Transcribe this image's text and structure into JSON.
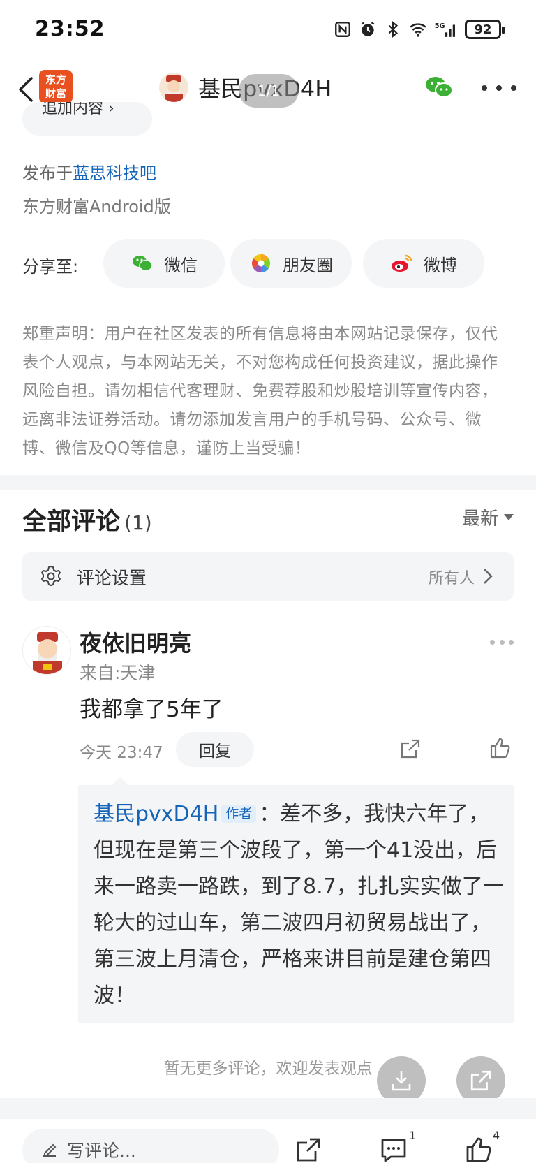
{
  "status": {
    "time": "23:52",
    "battery": "92",
    "network": "5G"
  },
  "nav": {
    "logo_line1": "东方",
    "logo_line2": "财富",
    "title": "基民pvxD4H",
    "page_indicator": "1/1"
  },
  "post": {
    "cut_pill_text": "追加内容 ›",
    "published_prefix": "发布于",
    "published_forum": "蓝思科技吧",
    "client": "东方财富Android版"
  },
  "share": {
    "label": "分享至:",
    "buttons": [
      {
        "label": "微信",
        "icon": "wechat-icon"
      },
      {
        "label": "朋友圈",
        "icon": "moments-icon"
      },
      {
        "label": "微博",
        "icon": "weibo-icon"
      }
    ]
  },
  "disclaimer": "郑重声明：用户在社区发表的所有信息将由本网站记录保存，仅代表个人观点，与本网站无关，不对您构成任何投资建议，据此操作风险自担。请勿相信代客理财、免费荐股和炒股培训等宣传内容，远离非法证券活动。请勿添加发言用户的手机号码、公众号、微博、微信及QQ等信息，谨防上当受骗！",
  "comments": {
    "title": "全部评论",
    "count": "(1)",
    "sort": "最新",
    "settings_label": "评论设置",
    "settings_value": "所有人",
    "items": [
      {
        "user": "夜依旧明亮",
        "location": "来自:天津",
        "text": "我都拿了5年了",
        "time": "今天 23:47",
        "reply_label": "回复",
        "reply": {
          "author": "基民pvxD4H",
          "tag": "作者",
          "text": "：差不多，我快六年了，但现在是第三个波段了，第一个41没出，后来一路卖一路跌，到了8.7，扎扎实实做了一轮大的过山车，第二波四月初贸易战出了，第三波上月清仓，严格来讲目前是建仓第四波！"
        }
      }
    ],
    "no_more": "暂无更多评论，欢迎发表观点"
  },
  "bottom_bar": {
    "write_placeholder": "写评论...",
    "comment_count": "1",
    "like_count": "4"
  },
  "colors": {
    "link": "#1664b8",
    "brand": "#e8501f",
    "panel": "#f4f5f7"
  }
}
